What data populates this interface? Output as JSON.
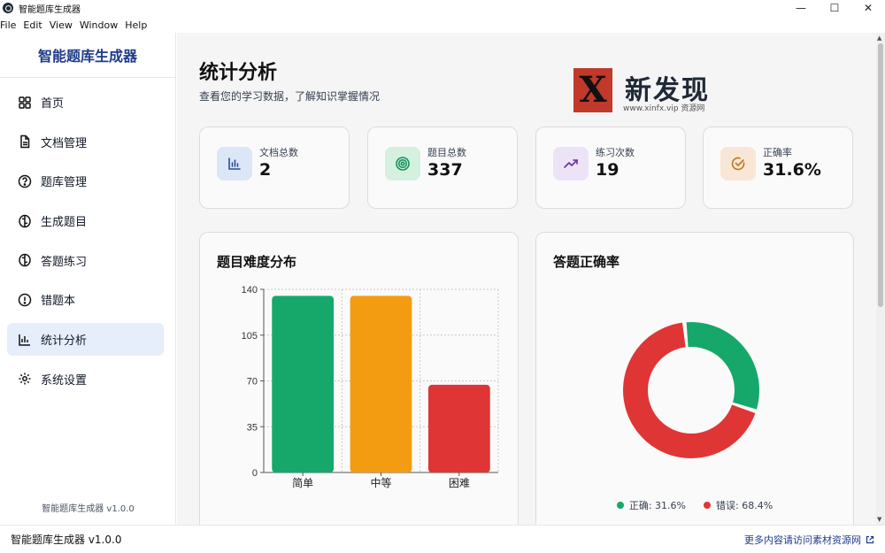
{
  "window": {
    "title": "智能题库生成器",
    "minimize": "—",
    "maximize": "☐",
    "close": "✕"
  },
  "menu": [
    "File",
    "Edit",
    "View",
    "Window",
    "Help"
  ],
  "sidebar": {
    "brand": "智能题库生成器",
    "items": [
      {
        "label": "首页",
        "icon": "grid-icon"
      },
      {
        "label": "文档管理",
        "icon": "document-icon"
      },
      {
        "label": "题库管理",
        "icon": "question-circle-icon"
      },
      {
        "label": "生成题目",
        "icon": "brain-icon"
      },
      {
        "label": "答题练习",
        "icon": "brain-icon"
      },
      {
        "label": "错题本",
        "icon": "alert-circle-icon"
      },
      {
        "label": "统计分析",
        "icon": "bar-chart-icon",
        "active": true
      },
      {
        "label": "系统设置",
        "icon": "gear-icon"
      }
    ],
    "version": "智能题库生成器 v1.0.0"
  },
  "page": {
    "title": "统计分析",
    "subtitle": "查看您的学习数据，了解知识掌握情况"
  },
  "watermark": {
    "mark": "X",
    "text": "新发现",
    "url": "www.xinfx.vip 资源网"
  },
  "stats": [
    {
      "label": "文档总数",
      "value": "2",
      "icon": "bar-chart-icon",
      "bg": "#dbe6f7",
      "fg": "#2b4c9a"
    },
    {
      "label": "题目总数",
      "value": "337",
      "icon": "target-icon",
      "bg": "#d5f0df",
      "fg": "#14925a"
    },
    {
      "label": "练习次数",
      "value": "19",
      "icon": "trending-up-icon",
      "bg": "#ece3f6",
      "fg": "#6b2fa0"
    },
    {
      "label": "正确率",
      "value": "31.6%",
      "icon": "check-circle-icon",
      "bg": "#f8e7d6",
      "fg": "#c2741a"
    }
  ],
  "difficulty_panel": {
    "title": "题目难度分布"
  },
  "accuracy_panel": {
    "title": "答题正确率"
  },
  "chart_data": [
    {
      "type": "bar",
      "title": "题目难度分布",
      "categories": [
        "简单",
        "中等",
        "困难"
      ],
      "values": [
        135,
        135,
        67
      ],
      "colors": [
        "#16a86b",
        "#f39c12",
        "#e03535"
      ],
      "ylim": [
        0,
        140
      ],
      "yticks": [
        0,
        35,
        70,
        105,
        140
      ],
      "grid": true
    },
    {
      "type": "pie",
      "title": "答题正确率",
      "donut": true,
      "slices": [
        {
          "label": "正确",
          "value": 31.6,
          "color": "#16a86b"
        },
        {
          "label": "错误",
          "value": 68.4,
          "color": "#e03535"
        }
      ],
      "legend": [
        {
          "label": "正确: 31.6%",
          "color": "#16a86b"
        },
        {
          "label": "错误: 68.4%",
          "color": "#e03535"
        }
      ],
      "legend_position": "bottom"
    }
  ],
  "statusbar": {
    "left": "智能题库生成器 v1.0.0",
    "link": "更多内容请访问素材资源网"
  }
}
